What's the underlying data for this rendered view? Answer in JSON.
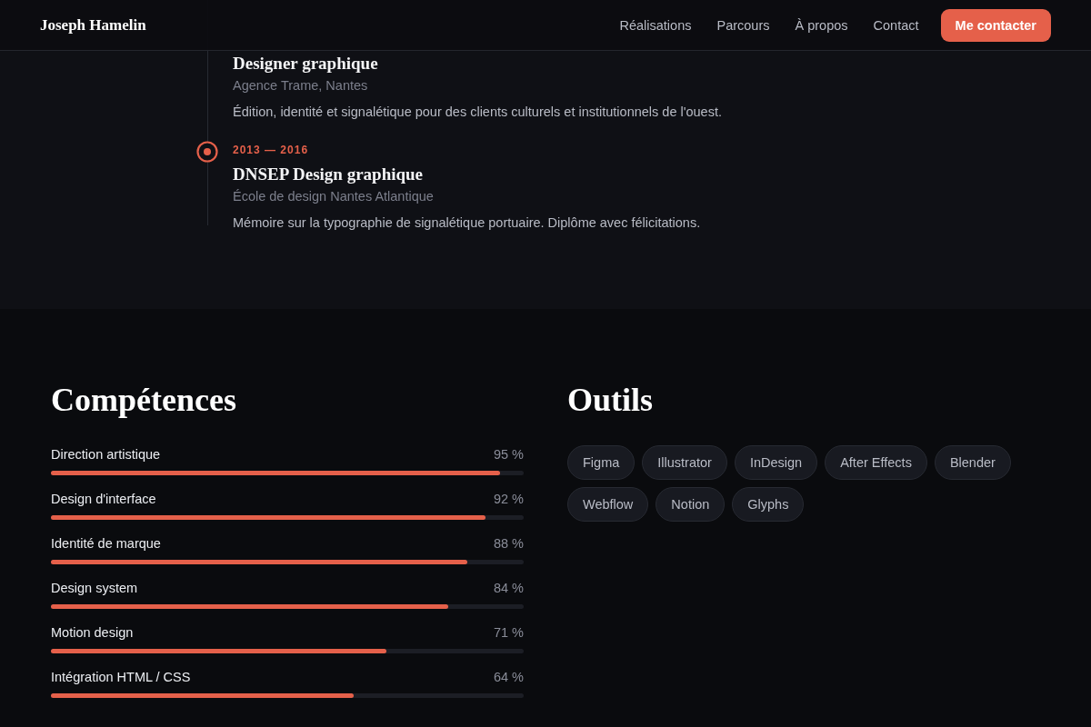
{
  "header": {
    "brand": "Joseph Hamelin",
    "nav": [
      "Réalisations",
      "Parcours",
      "À propos",
      "Contact"
    ],
    "cta": "Me contacter"
  },
  "timeline": [
    {
      "title": "Designer graphique",
      "place": "Agence Trame, Nantes",
      "description": "Édition, identité et signalétique pour des clients culturels et institutionnels de l'ouest."
    },
    {
      "period": "2013 — 2016",
      "title": "DNSEP Design graphique",
      "place": "École de design Nantes Atlantique",
      "description": "Mémoire sur la typographie de signalétique portuaire. Diplôme avec félicitations."
    }
  ],
  "skills": {
    "heading": "Compétences",
    "items": [
      {
        "name": "Direction artistique",
        "reading": "95 %",
        "level": 0.95
      },
      {
        "name": "Design d'interface",
        "reading": "92 %",
        "level": 0.92
      },
      {
        "name": "Identité de marque",
        "reading": "88 %",
        "level": 0.88
      },
      {
        "name": "Design system",
        "reading": "84 %",
        "level": 0.84
      },
      {
        "name": "Motion design",
        "reading": "71 %",
        "level": 0.71
      },
      {
        "name": "Intégration HTML / CSS",
        "reading": "64 %",
        "level": 0.64
      }
    ]
  },
  "tools": {
    "heading": "Outils",
    "items": [
      "Figma",
      "Illustrator",
      "InDesign",
      "After Effects",
      "Blender",
      "Webflow",
      "Notion",
      "Glyphs"
    ]
  }
}
